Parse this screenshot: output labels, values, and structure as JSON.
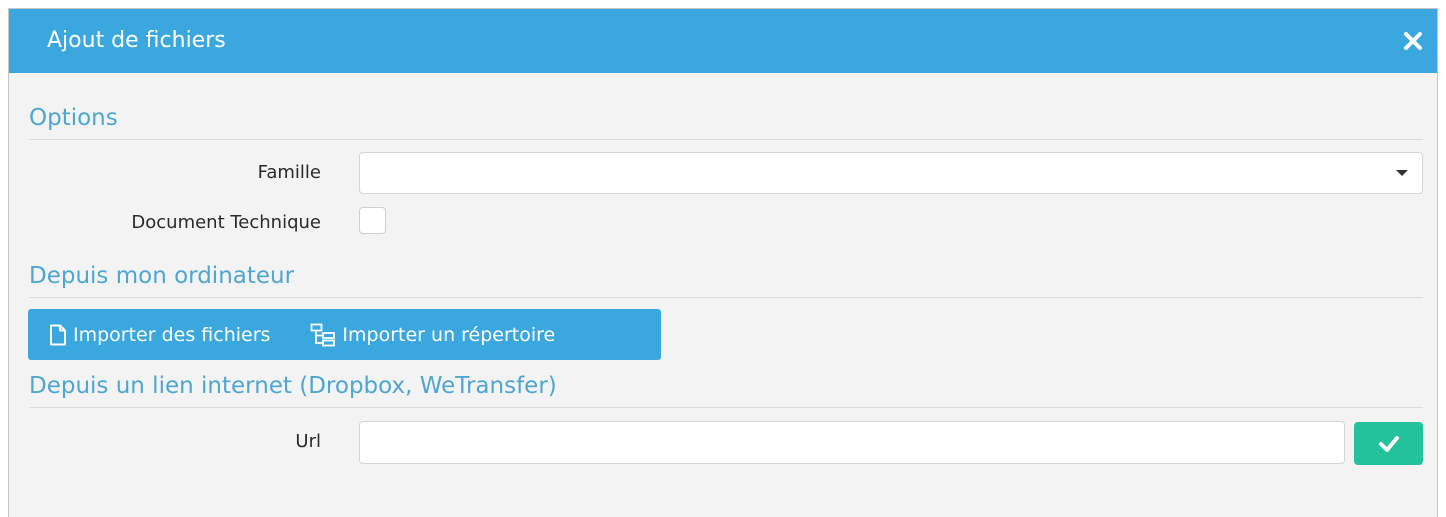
{
  "dialog": {
    "title": "Ajout de fichiers",
    "close_icon": "close-icon"
  },
  "options": {
    "heading": "Options",
    "famille_label": "Famille",
    "famille_value": "",
    "document_technique_label": "Document Technique",
    "document_technique_checked": false
  },
  "computer": {
    "heading": "Depuis mon ordinateur",
    "import_files_label": "Importer des fichiers",
    "import_files_icon": "file-icon",
    "import_folder_label": "Importer un répertoire",
    "import_folder_icon": "folder-tree-icon"
  },
  "link": {
    "heading": "Depuis un lien internet (Dropbox, WeTransfer)",
    "url_label": "Url",
    "url_value": "",
    "confirm_icon": "check-icon"
  },
  "colors": {
    "header": "#3aa8de",
    "section_heading": "#4ea6d2",
    "confirm": "#22c29c"
  }
}
